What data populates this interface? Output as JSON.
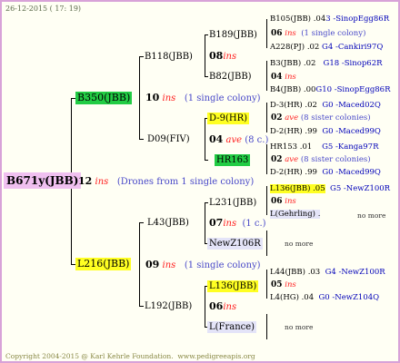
{
  "header": {
    "date": "26-12-2015 ( 17: 19)"
  },
  "root": {
    "name": "B671y(JBB)",
    "gen": "12",
    "type": "ins",
    "note": "(Drones from 1 single colony)"
  },
  "father": {
    "name": "B350(JBB)",
    "gen": "10",
    "type": "ins",
    "note": "(1 single colony)"
  },
  "mother": {
    "name": "L216(JBB)",
    "gen": "09",
    "type": "ins",
    "note": "(1 single colony)"
  },
  "b118": {
    "name": "B118(JBB)"
  },
  "b189": {
    "name": "B189(JBB)",
    "gen": "08",
    "type": "ins"
  },
  "b82": {
    "name": "B82(JBB)"
  },
  "d09": {
    "name": "D09(FIV)",
    "gen": "04",
    "type": "ave",
    "note": "(8 c.)"
  },
  "d9": {
    "name": "D-9(HR)"
  },
  "hr163": {
    "name": "HR163"
  },
  "l43": {
    "name": "L43(JBB)",
    "gen": "07",
    "type": "ins",
    "note": "(1 c.)"
  },
  "l231": {
    "name": "L231(JBB)"
  },
  "newz106r": {
    "name": "NewZ106R"
  },
  "l192": {
    "name": "L192(JBB)",
    "gen": "06",
    "type": "ins"
  },
  "l136": {
    "name": "L136(JBB)"
  },
  "lfrance": {
    "name": "L(France)"
  },
  "right": {
    "r1": "B105(JBB) .04",
    "r1b": "3 -SinopEgg86R",
    "r2_gen": "06",
    "r2_type": "ins",
    "r2_note": "(1 single colony)",
    "r3": "A228(PJ) .02",
    "r3b": "G4 -Cankiri97Q",
    "r4": "B3(JBB) .02",
    "r4b": "G18 -Sinop62R",
    "r5_gen": "04",
    "r5_type": "ins",
    "r6": "B4(JBB) .00",
    "r6b": "G10 -SinopEgg86R",
    "r7": "D-3(HR) .02",
    "r7b": "G0 -Maced02Q",
    "r8_gen": "02",
    "r8_type": "ave",
    "r8_note": "(8 sister colonies)",
    "r9": "D-2(HR) .99",
    "r9b": "G0 -Maced99Q",
    "r10": "HR153 .01",
    "r10b": "G5 -Kanga97R",
    "r11_gen": "02",
    "r11_type": "ave",
    "r11_note": "(8 sister colonies)",
    "r12": "D-2(HR) .99",
    "r12b": "G0 -Maced99Q",
    "r13": "L136(JBB) .05",
    "r13b": "G5 -NewZ100R",
    "r14_gen": "06",
    "r14_type": "ins",
    "r15": "L(Gehrling) .",
    "r15b": "no more",
    "r16": "no more",
    "r17": "L44(JBB) .03",
    "r17b": "G4 -NewZ100R",
    "r18_gen": "05",
    "r18_type": "ins",
    "r19": "L4(HG) .04",
    "r19b": "G0 -NewZ104Q",
    "r20": "no more"
  },
  "footer": {
    "copyright": "Copyright 2004-2015 @ Karl Kehrle Foundation.",
    "site": "www.pedigreeapis.org"
  },
  "colors": {
    "border": "#d8a2d8",
    "root_bg": "#f0c0f0",
    "highlight_yellow": "#ffff22",
    "highlight_green": "#22cc44",
    "ins_red": "#ff2020",
    "note_blue": "#4848c8"
  }
}
